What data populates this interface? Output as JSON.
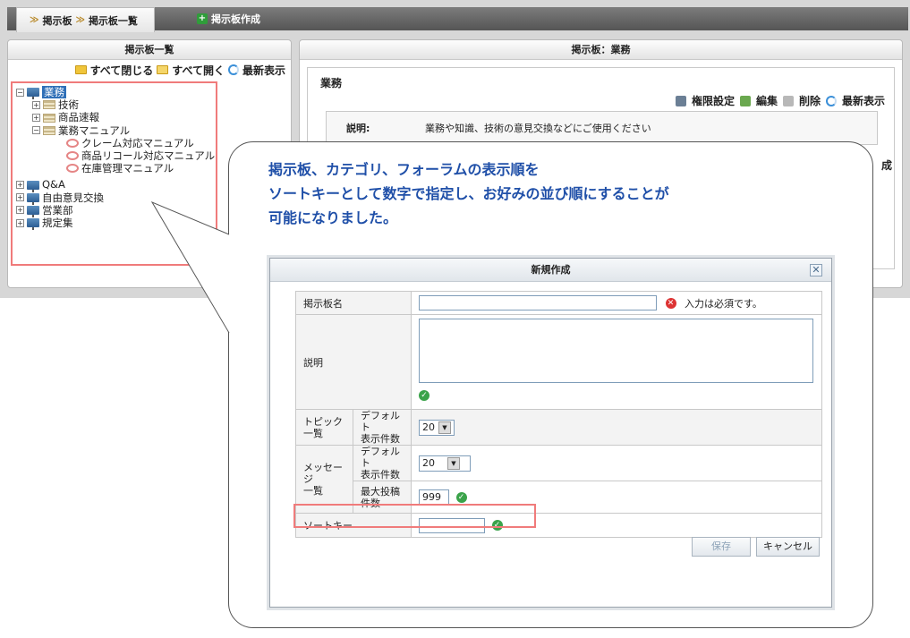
{
  "breadcrumb": {
    "item1": "掲示板",
    "item2": "掲示板一覧"
  },
  "active_tab": "掲示板作成",
  "left_panel": {
    "title": "掲示板一覧",
    "tools": {
      "close_all": "すべて閉じる",
      "open_all": "すべて開く",
      "refresh": "最新表示"
    },
    "tree": [
      {
        "label": "業務",
        "level": 0,
        "expanded": true,
        "selected": true,
        "type": "board"
      },
      {
        "label": "技術",
        "level": 1,
        "expanded": false,
        "type": "category"
      },
      {
        "label": "商品速報",
        "level": 1,
        "expanded": false,
        "type": "category"
      },
      {
        "label": "業務マニュアル",
        "level": 1,
        "expanded": true,
        "type": "category"
      },
      {
        "label": "クレーム対応マニュアル",
        "level": 2,
        "type": "forum"
      },
      {
        "label": "商品リコール対応マニュアル",
        "level": 2,
        "type": "forum"
      },
      {
        "label": "在庫管理マニュアル",
        "level": 2,
        "type": "forum"
      },
      {
        "label": "Q&A",
        "level": 0,
        "expanded": false,
        "type": "board"
      },
      {
        "label": "自由意見交換",
        "level": 0,
        "expanded": false,
        "type": "board"
      },
      {
        "label": "営業部",
        "level": 0,
        "expanded": false,
        "type": "board"
      },
      {
        "label": "規定集",
        "level": 0,
        "expanded": false,
        "type": "board"
      }
    ]
  },
  "right_panel": {
    "title": "掲示板：業務",
    "board_name": "業務",
    "tools": {
      "permissions": "権限設定",
      "edit": "編集",
      "delete": "削除",
      "refresh": "最新表示"
    },
    "description_label": "説明:",
    "description_text": "業務や知識、技術の意見交換などにご使用ください",
    "partial_text": "成"
  },
  "callout": {
    "line1": "掲示板、カテゴリ、フォーラムの表示順を",
    "line2": "ソートキーとして数字で指定し、お好みの並び順にすることが",
    "line3": "可能になりました。"
  },
  "dialog": {
    "title": "新規作成",
    "board_name_label": "掲示板名",
    "required_msg": "入力は必須です。",
    "description_label": "説明",
    "topic_list_label": "トピック\n一覧",
    "default_count_label": "デフォルト\n表示件数",
    "topic_default_count": "20",
    "message_list_label": "メッセージ\n一覧",
    "message_default_count": "20",
    "max_posts_label": "最大投稿\n件数",
    "max_posts_value": "999",
    "sort_key_label": "ソートキー",
    "save_label": "保存",
    "cancel_label": "キャンセル"
  },
  "colors": {
    "highlight": "#f07b7b",
    "callout_text": "#1f4fa8",
    "selected_node": "#2f6fb7"
  }
}
